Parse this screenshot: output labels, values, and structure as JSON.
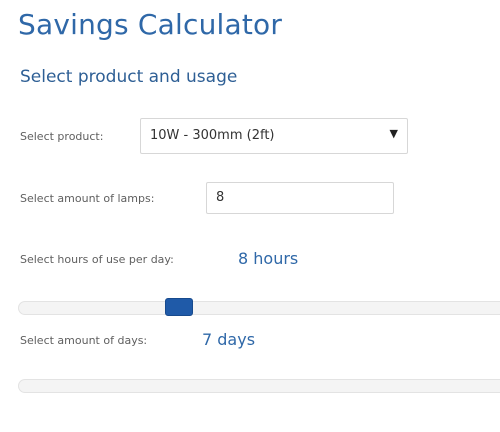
{
  "page_title": "Savings Calculator",
  "section_title": "Select product and usage",
  "product": {
    "label": "Select product:",
    "selected": "10W - 300mm (2ft)"
  },
  "lamps": {
    "label": "Select amount of lamps:",
    "value": "8"
  },
  "hours": {
    "label": "Select hours of use per day:",
    "value_text": "8 hours",
    "value": 8,
    "min": 0,
    "max": 24
  },
  "days": {
    "label": "Select amount of days:",
    "value_text": "7 days",
    "value": 7
  },
  "icons": {
    "dropdown": "chevron-down-icon"
  },
  "colors": {
    "heading": "#2f68a8",
    "slider_thumb": "#1f5aa8"
  }
}
